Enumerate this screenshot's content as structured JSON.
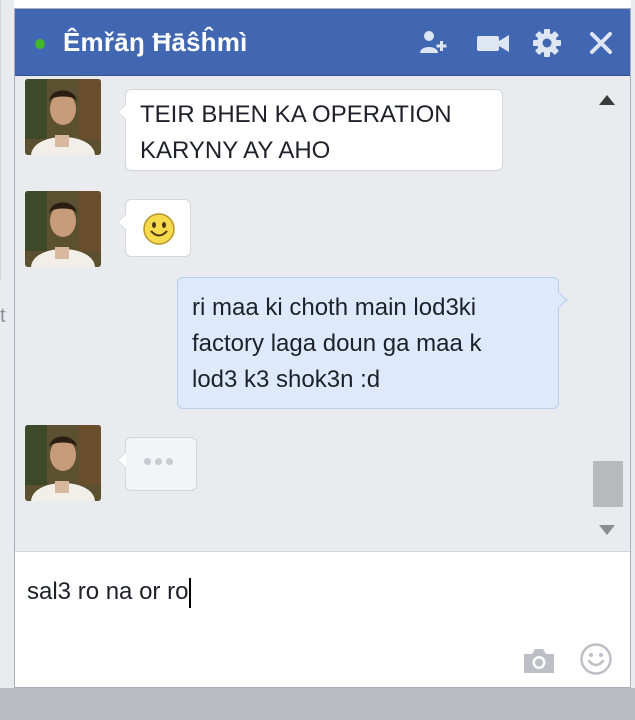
{
  "chat_window": {
    "title": "Êmřāŋ Ħāŝĥmì",
    "status": "online",
    "colors": {
      "header": "#4267b2",
      "online_dot": "#42b72a",
      "incoming_bubble": "#ffffff",
      "outgoing_bubble": "#deeafb"
    },
    "header_icons": [
      "add-friend-icon",
      "video-call-icon",
      "gear-icon",
      "close-icon"
    ]
  },
  "messages": [
    {
      "direction": "incoming",
      "type": "text",
      "lines": [
        "TEIR BHEN KA OPERATION",
        "KARYNY AY AHO"
      ]
    },
    {
      "direction": "incoming",
      "type": "emoji",
      "icon": "smiley-emoji-icon"
    },
    {
      "direction": "outgoing",
      "type": "text",
      "lines": [
        "ri maa ki choth main lod3ki",
        "factory laga doun ga maa k",
        "lod3 k3 shok3n :d"
      ]
    },
    {
      "direction": "incoming",
      "type": "typing",
      "icon": "typing-indicator-icon"
    }
  ],
  "composer": {
    "value": "sal3 ro na or ro",
    "icons": [
      "camera-icon",
      "emoji-icon"
    ]
  }
}
